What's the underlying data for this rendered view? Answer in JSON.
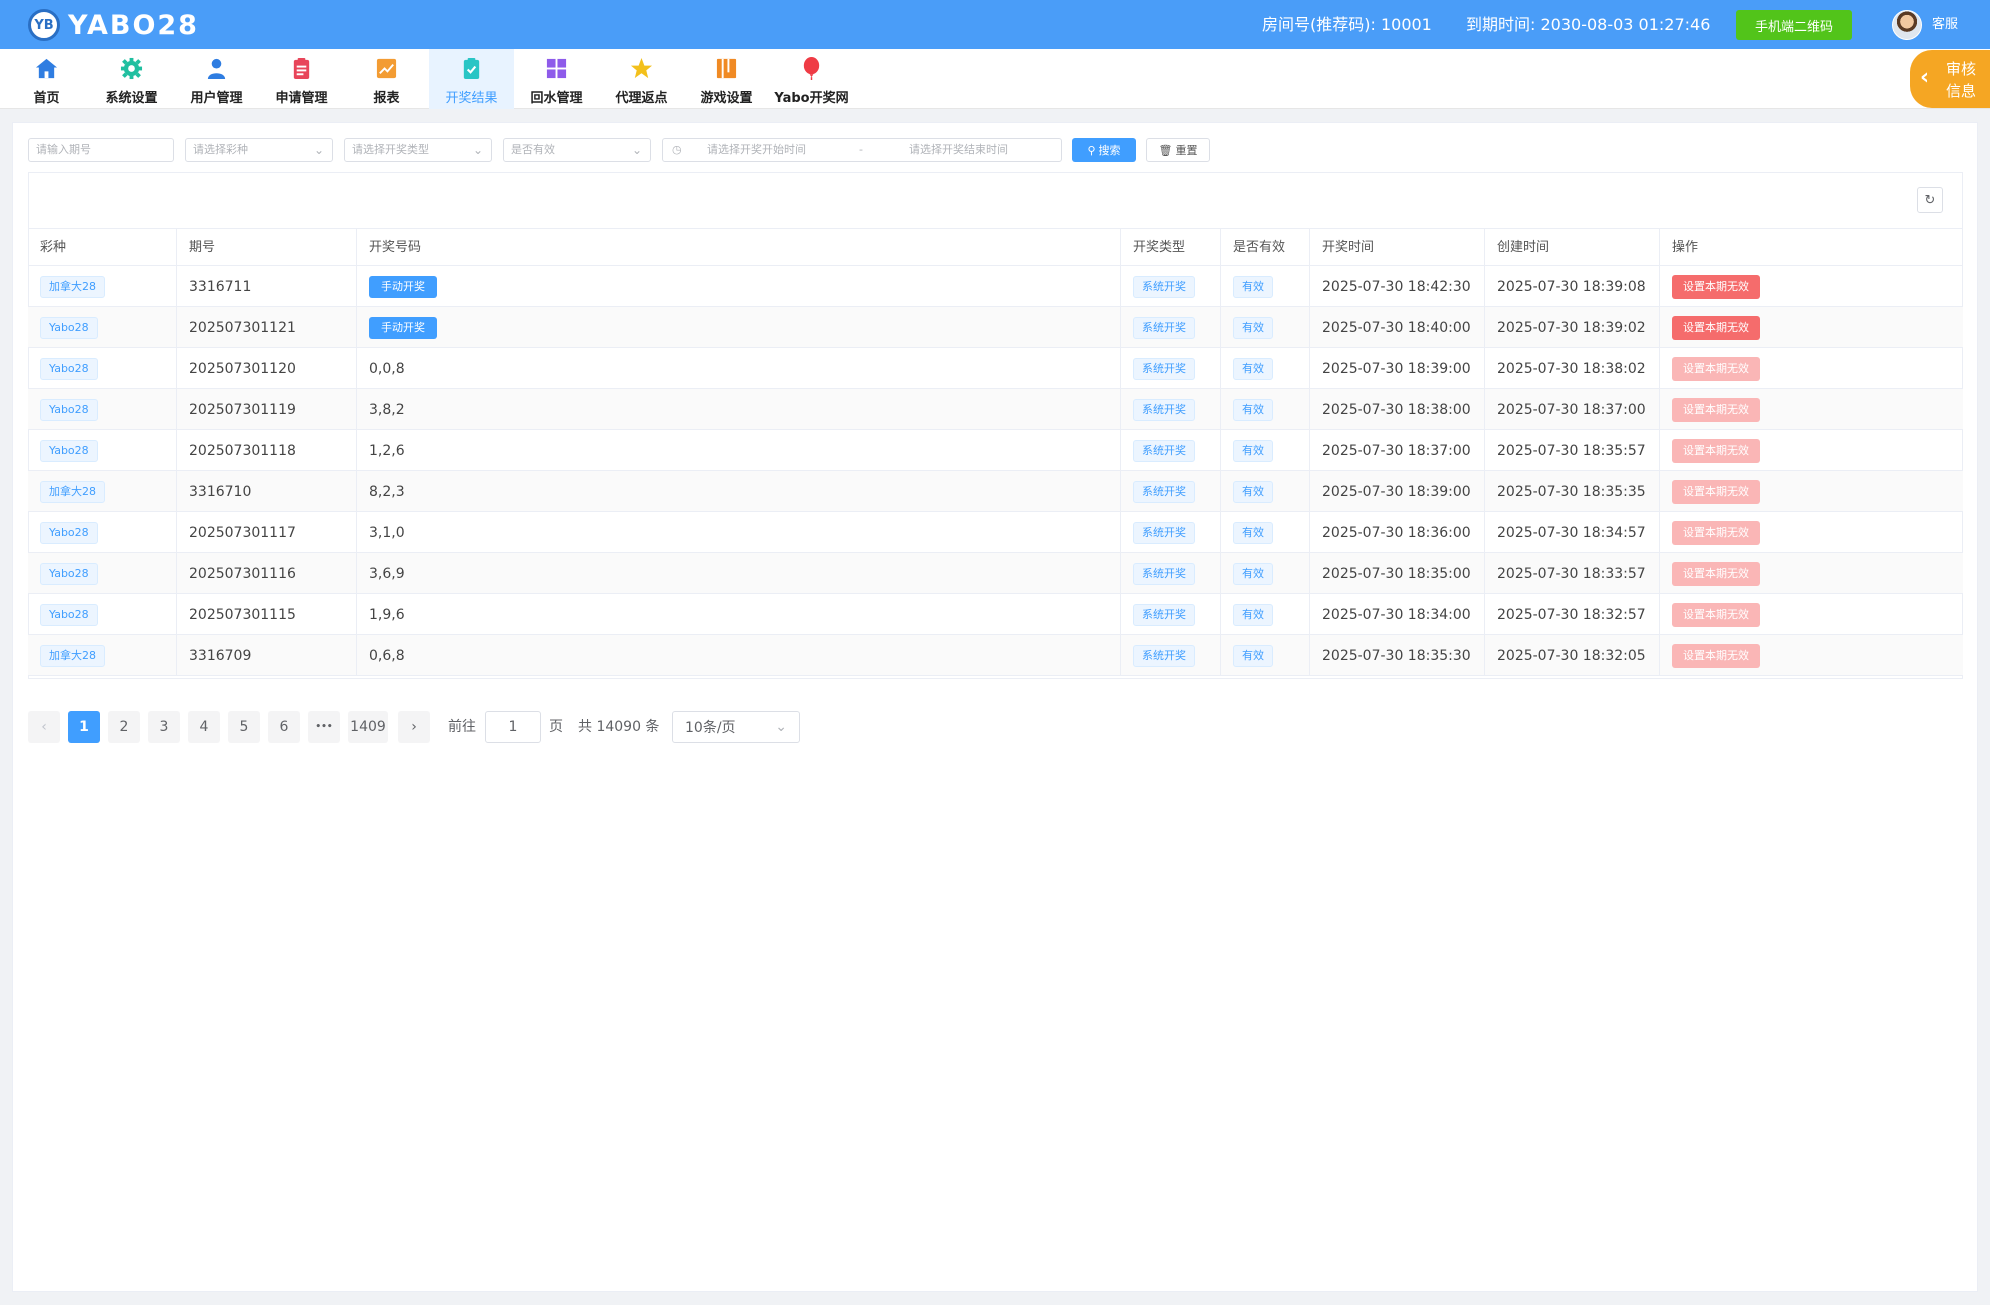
{
  "header": {
    "logo_mark": "YB",
    "logo_text": "YABO28",
    "room_info": "房间号(推荐码): 10001",
    "expire_info": "到期时间: 2030-08-03 01:27:46",
    "qr_button": "手机端二维码",
    "user": "客服"
  },
  "nav": {
    "items": [
      {
        "label": "首页",
        "icon": "home-icon",
        "color": "#2f7de1"
      },
      {
        "label": "系统设置",
        "icon": "gear-icon",
        "color": "#1fbfa0"
      },
      {
        "label": "用户管理",
        "icon": "user-icon",
        "color": "#2f7de1"
      },
      {
        "label": "申请管理",
        "icon": "clipboard-icon",
        "color": "#e8455a"
      },
      {
        "label": "报表",
        "icon": "chart-icon",
        "color": "#f39c33"
      },
      {
        "label": "开奖结果",
        "icon": "result-icon",
        "color": "#29c5c5"
      },
      {
        "label": "回水管理",
        "icon": "grid-icon",
        "color": "#8e5bea"
      },
      {
        "label": "代理返点",
        "icon": "star-icon",
        "color": "#f3c01b"
      },
      {
        "label": "游戏设置",
        "icon": "book-icon",
        "color": "#f08a24"
      },
      {
        "label": "Yabo开奖网",
        "icon": "balloon-icon",
        "color": "#ef3b45"
      }
    ],
    "active_index": 5
  },
  "audit_tab": {
    "line1": "审核",
    "line2": "信息"
  },
  "filters": {
    "issue_placeholder": "请输入期号",
    "lottery_placeholder": "请选择彩种",
    "draw_type_placeholder": "请选择开奖类型",
    "valid_placeholder": "是否有效",
    "start_placeholder": "请选择开奖开始时间",
    "range_sep": "-",
    "end_placeholder": "请选择开奖结束时间",
    "search_label": "搜索",
    "reset_label": "重置"
  },
  "table": {
    "columns": [
      "彩种",
      "期号",
      "开奖号码",
      "开奖类型",
      "是否有效",
      "开奖时间",
      "创建时间",
      "操作"
    ],
    "rows": [
      {
        "lottery": "加拿大28",
        "issue": "3316711",
        "numbers": "",
        "manual": "手动开奖",
        "type": "系统开奖",
        "valid": "有效",
        "draw_time": "2025-07-30 18:42:30",
        "created": "2025-07-30 18:39:08",
        "action": "设置本期无效",
        "action_enabled": true
      },
      {
        "lottery": "Yabo28",
        "issue": "202507301121",
        "numbers": "",
        "manual": "手动开奖",
        "type": "系统开奖",
        "valid": "有效",
        "draw_time": "2025-07-30 18:40:00",
        "created": "2025-07-30 18:39:02",
        "action": "设置本期无效",
        "action_enabled": true
      },
      {
        "lottery": "Yabo28",
        "issue": "202507301120",
        "numbers": "0,0,8",
        "manual": "",
        "type": "系统开奖",
        "valid": "有效",
        "draw_time": "2025-07-30 18:39:00",
        "created": "2025-07-30 18:38:02",
        "action": "设置本期无效",
        "action_enabled": false
      },
      {
        "lottery": "Yabo28",
        "issue": "202507301119",
        "numbers": "3,8,2",
        "manual": "",
        "type": "系统开奖",
        "valid": "有效",
        "draw_time": "2025-07-30 18:38:00",
        "created": "2025-07-30 18:37:00",
        "action": "设置本期无效",
        "action_enabled": false
      },
      {
        "lottery": "Yabo28",
        "issue": "202507301118",
        "numbers": "1,2,6",
        "manual": "",
        "type": "系统开奖",
        "valid": "有效",
        "draw_time": "2025-07-30 18:37:00",
        "created": "2025-07-30 18:35:57",
        "action": "设置本期无效",
        "action_enabled": false
      },
      {
        "lottery": "加拿大28",
        "issue": "3316710",
        "numbers": "8,2,3",
        "manual": "",
        "type": "系统开奖",
        "valid": "有效",
        "draw_time": "2025-07-30 18:39:00",
        "created": "2025-07-30 18:35:35",
        "action": "设置本期无效",
        "action_enabled": false
      },
      {
        "lottery": "Yabo28",
        "issue": "202507301117",
        "numbers": "3,1,0",
        "manual": "",
        "type": "系统开奖",
        "valid": "有效",
        "draw_time": "2025-07-30 18:36:00",
        "created": "2025-07-30 18:34:57",
        "action": "设置本期无效",
        "action_enabled": false
      },
      {
        "lottery": "Yabo28",
        "issue": "202507301116",
        "numbers": "3,6,9",
        "manual": "",
        "type": "系统开奖",
        "valid": "有效",
        "draw_time": "2025-07-30 18:35:00",
        "created": "2025-07-30 18:33:57",
        "action": "设置本期无效",
        "action_enabled": false
      },
      {
        "lottery": "Yabo28",
        "issue": "202507301115",
        "numbers": "1,9,6",
        "manual": "",
        "type": "系统开奖",
        "valid": "有效",
        "draw_time": "2025-07-30 18:34:00",
        "created": "2025-07-30 18:32:57",
        "action": "设置本期无效",
        "action_enabled": false
      },
      {
        "lottery": "加拿大28",
        "issue": "3316709",
        "numbers": "0,6,8",
        "manual": "",
        "type": "系统开奖",
        "valid": "有效",
        "draw_time": "2025-07-30 18:35:30",
        "created": "2025-07-30 18:32:05",
        "action": "设置本期无效",
        "action_enabled": false
      }
    ]
  },
  "pagination": {
    "prev": "‹",
    "pages": [
      "1",
      "2",
      "3",
      "4",
      "5",
      "6"
    ],
    "ellipsis": "•••",
    "last": "1409",
    "next": "›",
    "goto_label": "前往",
    "goto_value": "1",
    "page_unit": "页",
    "total": "共 14090 条",
    "page_size": "10条/页",
    "current": "1"
  },
  "colors": {
    "header_bg": "#4a9df8",
    "primary": "#409eff",
    "danger": "#f56c6c",
    "danger_disabled": "#fab6b6",
    "success": "#52c41a",
    "audit": "#f5a623"
  }
}
